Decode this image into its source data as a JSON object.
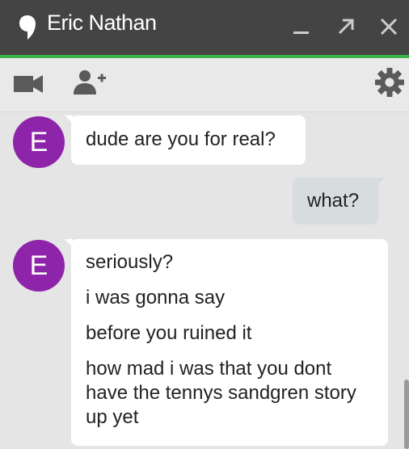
{
  "window": {
    "title": "Eric Nathan",
    "controls": [
      "minimize-icon",
      "popout-icon",
      "close-icon"
    ]
  },
  "toolbar": {
    "left_icons": [
      "video-call-icon",
      "add-person-icon"
    ],
    "right_icon": "gear-icon"
  },
  "messages": [
    {
      "from": "them",
      "avatar_initial": "E",
      "lines": [
        "dude are you for real?"
      ]
    },
    {
      "from": "me",
      "lines": [
        "what?"
      ]
    },
    {
      "from": "them",
      "avatar_initial": "E",
      "lines": [
        "seriously?",
        "i was gonna say",
        "before you ruined it",
        "how mad i was that you dont have the tennys sandgren story up yet"
      ]
    }
  ],
  "colors": {
    "titlebar": "#444444",
    "accent_green": "#3ab34a",
    "avatar": "#8e24aa",
    "outgoing_bubble": "#d7dcde"
  }
}
